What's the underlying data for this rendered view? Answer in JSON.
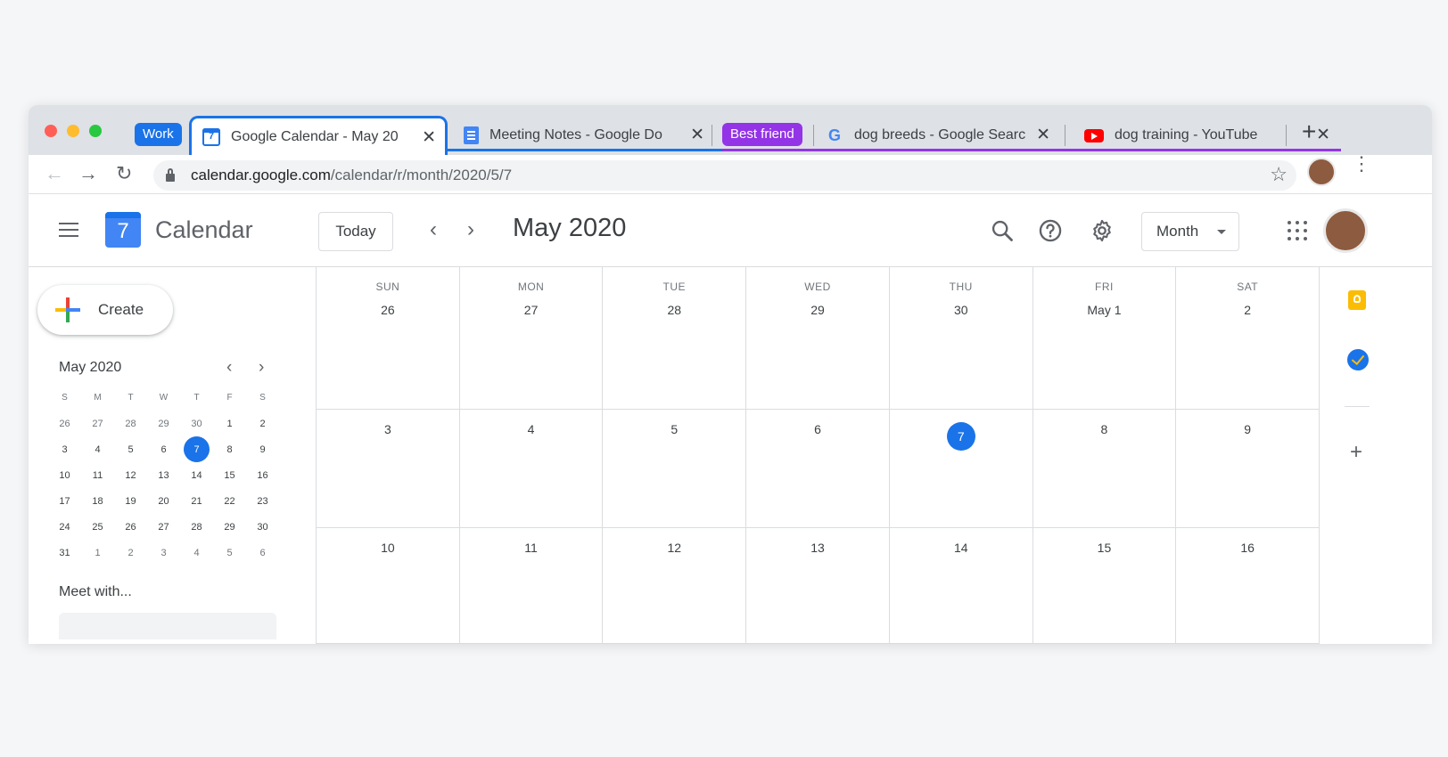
{
  "browser": {
    "tab_groups": [
      {
        "label": "Work",
        "color": "#1a73e8"
      },
      {
        "label": "Best friend",
        "color": "#9334e6"
      }
    ],
    "tabs": [
      {
        "title": "Google Calendar - May 20",
        "favicon": "calendar-icon",
        "fav_text": "7",
        "active": true
      },
      {
        "title": "Meeting Notes - Google Do",
        "favicon": "docs-icon",
        "active": false
      },
      {
        "title": "dog breeds - Google Searc",
        "favicon": "google-icon",
        "fav_text": "G",
        "active": false
      },
      {
        "title": "dog training - YouTube",
        "favicon": "youtube-icon",
        "active": false
      }
    ],
    "tab_close_glyph": "✕",
    "new_tab_glyph": "+",
    "address": {
      "domain": "calendar.google.com",
      "path": "/calendar/r/month/2020/5/7"
    },
    "nav": {
      "back": "←",
      "forward": "→",
      "reload": "↻",
      "star": "☆",
      "menu": "⋮"
    }
  },
  "calendar": {
    "app_name": "Calendar",
    "logo_day": "7",
    "today_label": "Today",
    "prev": "‹",
    "next": "›",
    "period_title": "May 2020",
    "view_label": "Month",
    "create_label": "Create",
    "mini": {
      "title": "May 2020",
      "prev": "‹",
      "next": "›",
      "weekday_heads": [
        "S",
        "M",
        "T",
        "W",
        "T",
        "F",
        "S"
      ],
      "weeks": [
        [
          "26",
          "27",
          "28",
          "29",
          "30",
          "1",
          "2"
        ],
        [
          "3",
          "4",
          "5",
          "6",
          "7",
          "8",
          "9"
        ],
        [
          "10",
          "11",
          "12",
          "13",
          "14",
          "15",
          "16"
        ],
        [
          "17",
          "18",
          "19",
          "20",
          "21",
          "22",
          "23"
        ],
        [
          "24",
          "25",
          "26",
          "27",
          "28",
          "29",
          "30"
        ],
        [
          "31",
          "1",
          "2",
          "3",
          "4",
          "5",
          "6"
        ]
      ],
      "today": "7"
    },
    "meet_with": "Meet with...",
    "month_grid": {
      "weekdays": [
        "SUN",
        "MON",
        "TUE",
        "WED",
        "THU",
        "FRI",
        "SAT"
      ],
      "weeks": [
        [
          "26",
          "27",
          "28",
          "29",
          "30",
          "May 1",
          "2"
        ],
        [
          "3",
          "4",
          "5",
          "6",
          "7",
          "8",
          "9"
        ],
        [
          "10",
          "11",
          "12",
          "13",
          "14",
          "15",
          "16"
        ]
      ],
      "today": "7"
    },
    "side_panel": {
      "add": "+"
    }
  },
  "colors": {
    "accent": "#1a73e8",
    "work_group": "#1a73e8",
    "friend_group": "#9334e6"
  }
}
